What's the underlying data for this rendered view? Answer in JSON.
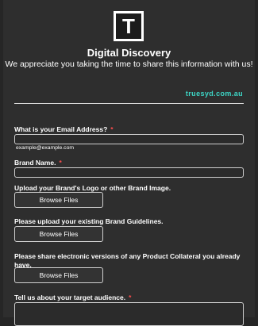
{
  "form": {
    "logo_letter": "T",
    "title": "Digital Discovery",
    "subtitle": "We appreciate you taking the time to share this information with us!",
    "site": "truesyd.com.au",
    "required_mark": "*",
    "fields": {
      "email": {
        "label": "What is your Email Address?",
        "value": "",
        "hint": "example@example.com"
      },
      "brand_name": {
        "label": "Brand Name.",
        "value": ""
      },
      "logo_upload": {
        "label": "Upload your Brand's Logo or other Brand Image.",
        "button": "Browse Files"
      },
      "guidelines_upload": {
        "label": "Please upload your existing Brand Guidelines.",
        "button": "Browse Files"
      },
      "collateral_upload": {
        "label": "Please share electronic versions of any Product Collateral you already have.",
        "button": "Browse Files"
      },
      "target_audience": {
        "label": "Tell us about your target audience."
      }
    }
  },
  "colors": {
    "background": "#2e2e2e",
    "accent": "#3dd6c6",
    "required": "#ff4d4d"
  }
}
